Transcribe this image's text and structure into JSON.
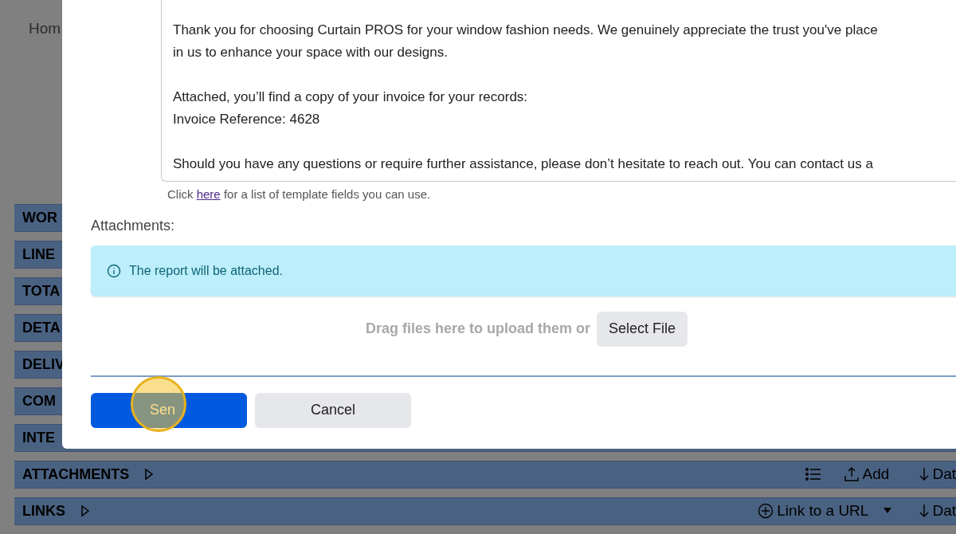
{
  "background": {
    "sidebar_text": "Hom",
    "sections": [
      {
        "label": "WOR",
        "kind": "plain"
      },
      {
        "label": "LINE",
        "kind": "plain"
      },
      {
        "label": "TOTA",
        "kind": "plain"
      },
      {
        "label": "DETA",
        "kind": "plain"
      },
      {
        "label": "DELIV",
        "kind": "plain"
      },
      {
        "label": "COM",
        "kind": "plain"
      },
      {
        "label": "INTE",
        "kind": "plain"
      },
      {
        "label": "ATTACHMENTS",
        "kind": "attachments",
        "add": "Add",
        "sort": "Dat"
      },
      {
        "label": "LINKS",
        "kind": "links",
        "link": "Link to a URL",
        "sort": "Dat"
      }
    ]
  },
  "dialog": {
    "email_body": [
      [
        "Thank you for choosing Curtain PROS for your window fashion needs. We genuinely appreciate the trust you've place",
        "in us to enhance your space with our designs."
      ],
      [
        "Attached, you’ll find a copy of your invoice for your records:",
        "Invoice Reference: 4628"
      ],
      [
        "Should you have any questions or require further assistance, please don’t hesitate to reach out. You can contact us a"
      ]
    ],
    "hint": {
      "before": "Click",
      "link": "here",
      "after": "for a list of template fields you can use."
    },
    "attachments_label": "Attachments:",
    "info": "The report will be attached.",
    "drop_text": "Drag files here to upload them or",
    "select_file": "Select File",
    "send": "Sen",
    "cancel": "Cancel"
  }
}
